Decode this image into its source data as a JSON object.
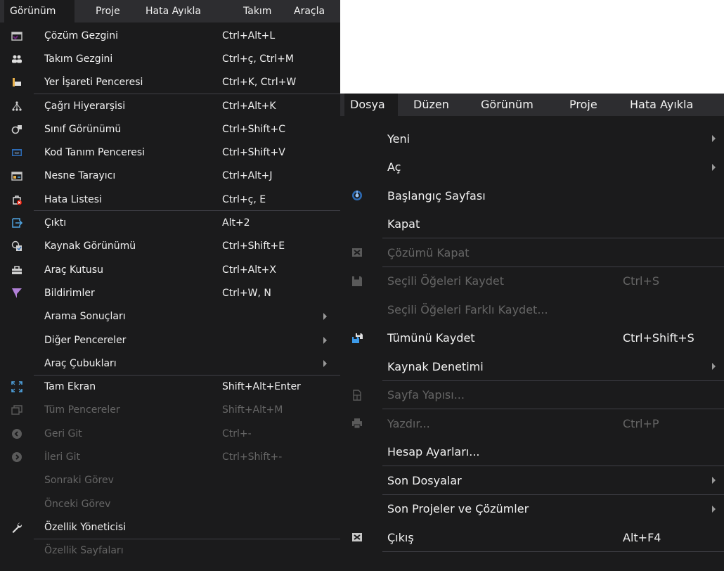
{
  "left_menu": {
    "menubar": [
      {
        "label": "Görünüm",
        "active": true
      },
      {
        "label": "Proje"
      },
      {
        "label": "Hata Ayıkla"
      },
      {
        "label": "Takım"
      },
      {
        "label": "Araçla"
      }
    ],
    "items": [
      {
        "label": "Çözüm Gezgini",
        "shortcut": "Ctrl+Alt+L",
        "icon": "solution-explorer-icon"
      },
      {
        "label": "Takım Gezgini",
        "shortcut": "Ctrl+ç, Ctrl+M",
        "icon": "team-explorer-icon"
      },
      {
        "label": "Yer İşareti Penceresi",
        "shortcut": "Ctrl+K, Ctrl+W",
        "icon": "bookmark-icon"
      },
      {
        "label": "Çağrı Hiyerarşisi",
        "shortcut": "Ctrl+Alt+K",
        "icon": "call-hierarchy-icon"
      },
      {
        "label": "Sınıf Görünümü",
        "shortcut": "Ctrl+Shift+C",
        "icon": "class-view-icon"
      },
      {
        "label": "Kod Tanım Penceresi",
        "shortcut": "Ctrl+Shift+V",
        "icon": "code-definition-icon"
      },
      {
        "label": "Nesne Tarayıcı",
        "shortcut": "Ctrl+Alt+J",
        "icon": "object-browser-icon"
      },
      {
        "label": "Hata Listesi",
        "shortcut": "Ctrl+ç, E",
        "icon": "error-list-icon"
      },
      {
        "label": "Çıktı",
        "shortcut": "Alt+2",
        "icon": "output-icon"
      },
      {
        "label": "Kaynak Görünümü",
        "shortcut": "Ctrl+Shift+E",
        "icon": "resource-view-icon"
      },
      {
        "label": "Araç Kutusu",
        "shortcut": "Ctrl+Alt+X",
        "icon": "toolbox-icon"
      },
      {
        "label": "Bildirimler",
        "shortcut": "Ctrl+W, N",
        "icon": "notifications-icon"
      },
      {
        "label": "Arama Sonuçları",
        "shortcut": "",
        "submenu": true
      },
      {
        "label": "Diğer Pencereler",
        "shortcut": "",
        "submenu": true
      },
      {
        "label": "Araç Çubukları",
        "shortcut": "",
        "submenu": true
      },
      {
        "label": "Tam Ekran",
        "shortcut": "Shift+Alt+Enter",
        "icon": "full-screen-icon"
      },
      {
        "label": "Tüm Pencereler",
        "shortcut": "Shift+Alt+M",
        "icon": "all-windows-icon",
        "disabled": true
      },
      {
        "label": "Geri Git",
        "shortcut": "Ctrl+-",
        "icon": "navigate-back-icon",
        "disabled": true
      },
      {
        "label": "İleri Git",
        "shortcut": "Ctrl+Shift+-",
        "icon": "navigate-forward-icon",
        "disabled": true
      },
      {
        "label": "Sonraki Görev",
        "shortcut": "",
        "disabled": true
      },
      {
        "label": "Önceki Görev",
        "shortcut": "",
        "disabled": true
      },
      {
        "label": "Özellik Yöneticisi",
        "shortcut": "",
        "icon": "property-manager-icon"
      },
      {
        "label": "Özellik Sayfaları",
        "shortcut": "",
        "disabled": true
      }
    ]
  },
  "right_menu": {
    "menubar": [
      {
        "label": "Dosya",
        "active": true
      },
      {
        "label": "Düzen"
      },
      {
        "label": "Görünüm"
      },
      {
        "label": "Proje"
      },
      {
        "label": "Hata Ayıkla"
      }
    ],
    "items": [
      {
        "label": "Yeni",
        "shortcut": "",
        "submenu": true
      },
      {
        "label": "Aç",
        "shortcut": "",
        "submenu": true
      },
      {
        "label": "Başlangıç Sayfası",
        "shortcut": "",
        "icon": "start-page-icon"
      },
      {
        "label": "Kapat",
        "shortcut": ""
      },
      {
        "label": "Çözümü Kapat",
        "shortcut": "",
        "icon": "close-solution-icon",
        "disabled": true
      },
      {
        "label": "Seçili Öğeleri Kaydet",
        "shortcut": "Ctrl+S",
        "icon": "save-icon",
        "disabled": true
      },
      {
        "label": "Seçili Öğeleri Farklı Kaydet...",
        "shortcut": "",
        "disabled": true
      },
      {
        "label": "Tümünü Kaydet",
        "shortcut": "Ctrl+Shift+S",
        "icon": "save-all-icon"
      },
      {
        "label": "Kaynak Denetimi",
        "shortcut": "",
        "submenu": true
      },
      {
        "label": "Sayfa Yapısı...",
        "shortcut": "",
        "icon": "page-setup-icon",
        "disabled": true
      },
      {
        "label": "Yazdır...",
        "shortcut": "Ctrl+P",
        "icon": "print-icon",
        "disabled": true
      },
      {
        "label": "Hesap Ayarları...",
        "shortcut": ""
      },
      {
        "label": "Son Dosyalar",
        "shortcut": "",
        "submenu": true
      },
      {
        "label": "Son Projeler ve Çözümler",
        "shortcut": "",
        "submenu": true
      },
      {
        "label": "Çıkış",
        "shortcut": "Alt+F4",
        "icon": "exit-icon"
      }
    ]
  }
}
